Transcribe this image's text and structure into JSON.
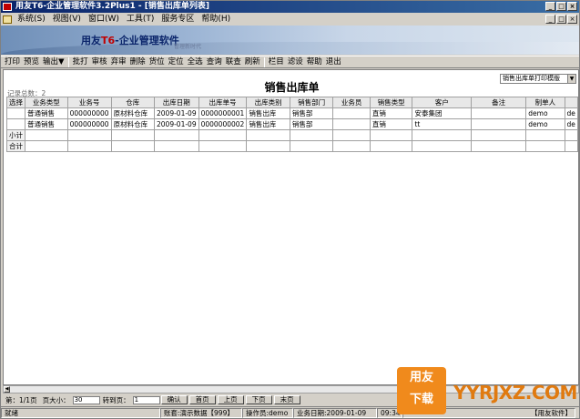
{
  "window": {
    "title": "用友T6-企业管理软件3.2Plus1 - [销售出库单列表]",
    "controls": [
      "_",
      "□",
      "×"
    ]
  },
  "menubar": {
    "items": [
      "系统(S)",
      "视图(V)",
      "窗口(W)",
      "工具(T)",
      "服务专区",
      "帮助(H)"
    ],
    "mdi_controls": [
      "_",
      "□",
      "×"
    ]
  },
  "banner": {
    "brand": "用友",
    "product_code": "T6",
    "product_name": "-企业管理软件",
    "subtitle": "管理新时代"
  },
  "toolbar": {
    "groups": [
      [
        "打印",
        "预览",
        "输出▼"
      ],
      [
        "批打",
        "审核",
        "弃审",
        "删除",
        "货位",
        "定位",
        "全选",
        "查询",
        "联查",
        "刷新"
      ],
      [
        "栏目",
        "滤设",
        "帮助",
        "退出"
      ]
    ]
  },
  "report": {
    "title": "销售出库单",
    "template": "销售出库单打印模版",
    "record_count": "记录总数：2"
  },
  "table": {
    "columns": [
      "选择",
      "业务类型",
      "业务号",
      "仓库",
      "出库日期",
      "出库单号",
      "出库类别",
      "销售部门",
      "业务员",
      "销售类型",
      "客户",
      "备注",
      "制单人",
      ""
    ],
    "rows": [
      [
        "",
        "普通销售",
        "000000000",
        "原材料仓库",
        "2009-01-09",
        "0000000001",
        "销售出库",
        "销售部",
        "",
        "直销",
        "安泰集团",
        "",
        "demo",
        "de"
      ],
      [
        "",
        "普通销售",
        "000000000",
        "原材料仓库",
        "2009-01-09",
        "0000000002",
        "销售出库",
        "销售部",
        "",
        "直销",
        "tt",
        "",
        "demo",
        "de"
      ]
    ],
    "subtotal_label": "小计",
    "total_label": "合计"
  },
  "pager": {
    "page_info": "第：1/1页",
    "page_size_label": "页大小：",
    "page_size_value": "30",
    "goto_label": "转到页：",
    "goto_value": "1",
    "buttons": [
      "确认",
      "首页",
      "上页",
      "下页",
      "末页"
    ]
  },
  "statusbar": {
    "ready": "就绪",
    "account": "账套:演示数据【999】",
    "operator": "操作员:demo",
    "business_date": "业务日期:2009-01-09",
    "time": "09:34",
    "vendor": "【用友软件】"
  },
  "watermark": {
    "logo_line1": "用友",
    "logo_line2": "下载",
    "site": "YYRJXZ.COM"
  },
  "colors": {
    "titlebar_start": "#0a246a",
    "titlebar_end": "#3a6ea5",
    "chrome": "#d4d0c8",
    "watermark_orange": "#f08a1c"
  }
}
